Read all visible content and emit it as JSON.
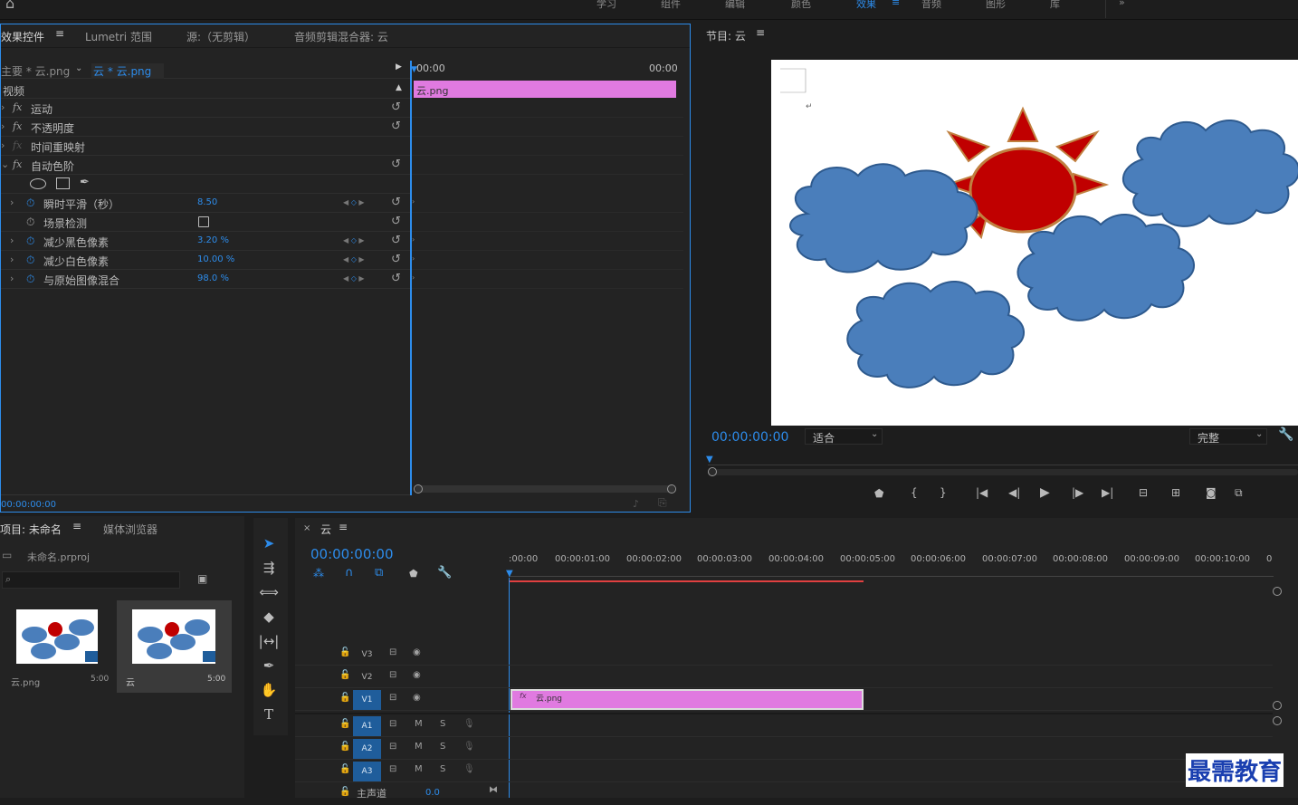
{
  "workspaces": [
    "学习",
    "组件",
    "编辑",
    "颜色",
    "效果",
    "音频",
    "图形",
    "库"
  ],
  "active_workspace_index": 4,
  "effect_controls": {
    "tabs": [
      "效果控件",
      "Lumetri 范围",
      "源:（无剪辑）",
      "音频剪辑混合器: 云"
    ],
    "master_clip": "主要 * 云.png",
    "sequence_clip": "云 * 云.png",
    "tl_start": "00:00",
    "tl_end": "00:00",
    "clip_bar_label": "云.png",
    "section_video": "视频",
    "effects": [
      {
        "name": "运动",
        "fx": "fx"
      },
      {
        "name": "不透明度",
        "fx": "fx"
      },
      {
        "name": "时间重映射",
        "fx": "fx"
      },
      {
        "name": "自动色阶",
        "fx": "fx"
      }
    ],
    "params": [
      {
        "name": "瞬时平滑（秒）",
        "value": "8.50"
      },
      {
        "name": "场景检测",
        "value": ""
      },
      {
        "name": "减少黑色像素",
        "value": "3.20 %"
      },
      {
        "name": "减少白色像素",
        "value": "10.00 %"
      },
      {
        "name": "与原始图像混合",
        "value": "98.0 %"
      }
    ],
    "timecode": "00:00:00:00"
  },
  "program_monitor": {
    "title": "节目: 云",
    "timecode": "00:00:00:00",
    "fit": "适合",
    "quality": "完整"
  },
  "project": {
    "title": "项目: 未命名",
    "media_browser": "媒体浏览器",
    "file": "未命名.prproj",
    "items": [
      {
        "name": "云.png",
        "duration": "5:00"
      },
      {
        "name": "云",
        "duration": "5:00"
      }
    ]
  },
  "timeline": {
    "sequence_name": "云",
    "timecode": "00:00:00:00",
    "ruler": [
      ":00:00",
      "00:00:01:00",
      "00:00:02:00",
      "00:00:03:00",
      "00:00:04:00",
      "00:00:05:00",
      "00:00:06:00",
      "00:00:07:00",
      "00:00:08:00",
      "00:00:09:00",
      "00:00:10:00",
      "0"
    ],
    "video_tracks": [
      "V3",
      "V2",
      "V1"
    ],
    "audio_tracks": [
      "A1",
      "A2",
      "A3"
    ],
    "mute": "M",
    "solo": "S",
    "master_track": "主声道",
    "master_value": "0.0",
    "clip_label": "云.png",
    "clip_fx": "fx"
  },
  "watermark": "最需教育",
  "colors": {
    "accent": "#2d8ceb",
    "clip": "#e07ae0",
    "track_on": "#1f5d9b",
    "sun": "#c00000",
    "cloud": "#4a7ebb"
  }
}
